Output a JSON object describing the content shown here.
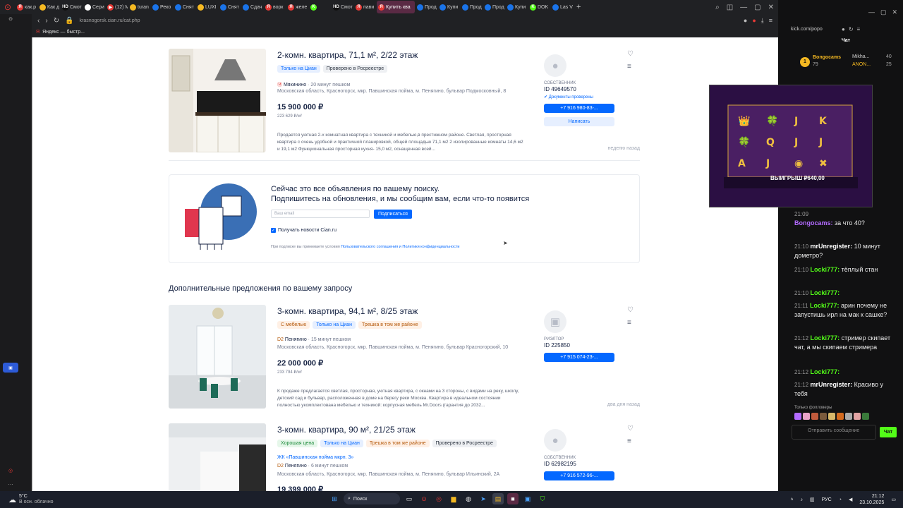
{
  "browser": {
    "tabs": [
      {
        "label": "как.р",
        "color": "#e53935",
        "glyph": "Я"
      },
      {
        "label": "Как д",
        "color": "#f5b922",
        "glyph": ""
      },
      {
        "label": "Смот",
        "color": "#111111",
        "glyph": "HD"
      },
      {
        "label": "Сери",
        "color": "#ffffff",
        "glyph": "▶"
      },
      {
        "label": "(12) М",
        "color": "#e53935",
        "glyph": "▶"
      },
      {
        "label": "turan",
        "color": "#f5b922",
        "glyph": ""
      },
      {
        "label": "Реко",
        "color": "#1a73e8",
        "glyph": ""
      },
      {
        "label": "Снят",
        "color": "#1a73e8",
        "glyph": ""
      },
      {
        "label": "LUXI",
        "color": "#f5b922",
        "glyph": ""
      },
      {
        "label": "Снят",
        "color": "#1a73e8",
        "glyph": ""
      },
      {
        "label": "Сдач",
        "color": "#1a73e8",
        "glyph": ""
      },
      {
        "label": "ворк",
        "color": "#e53935",
        "glyph": "Я"
      },
      {
        "label": "желе",
        "color": "#e53935",
        "glyph": "Я"
      },
      {
        "label": "",
        "color": "#53fc18",
        "glyph": "K"
      },
      {
        "label": "Смот",
        "color": "#111111",
        "glyph": "HD"
      },
      {
        "label": "пави",
        "color": "#e53935",
        "glyph": "Я"
      },
      {
        "label": "Купить ква",
        "color": "#e53935",
        "glyph": "Я",
        "active": true
      },
      {
        "label": "Прод",
        "color": "#1a73e8",
        "glyph": ""
      },
      {
        "label": "Купи",
        "color": "#1a73e8",
        "glyph": ""
      },
      {
        "label": "Прод",
        "color": "#1a73e8",
        "glyph": ""
      },
      {
        "label": "Прод",
        "color": "#1a73e8",
        "glyph": ""
      },
      {
        "label": "Купи",
        "color": "#1a73e8",
        "glyph": ""
      },
      {
        "label": "DOK",
        "color": "#53fc18",
        "glyph": "K"
      },
      {
        "label": "Las V",
        "color": "#1a73e8",
        "glyph": ""
      }
    ],
    "url": "krasnogorsk.cian.ru/cat.php",
    "bookmark": "Яндекс — быстр..."
  },
  "listings": [
    {
      "title": "2-комн. квартира, 71,1 м², 2/22 этаж",
      "chips": [
        {
          "text": "Только на Циан",
          "kind": "blue"
        },
        {
          "text": "Проверено в Росреестре",
          "kind": "grey"
        }
      ],
      "metro": "Мякинино",
      "walk": "· 20 минут пешком",
      "address": "Московская область, Красногорск, мкр. Павшинская пойма, м. Пенягино, бульвар Подмосковный, 8",
      "price": "15 900 000 ₽",
      "price_per_m": "223 629 ₽/м²",
      "description": "Продается уютная 2-х комнатная квартира с техникой и мебелью,в престижном районе. Светлая, просторная квартира с очень удобной и практичной планировкой, общей площадью 71,1 м2 2 изолированные комнаты 14,6 м2 и 19,1 м2 Функциональная просторная кухня- 15,0 м2, оснащенная всей...",
      "agent_role": "собственник",
      "agent_id": "ID 49649570",
      "verified": "Документы проверены",
      "phone": "+7 916 980-83-...",
      "write": "Написать",
      "ago": "неделю назад"
    },
    {
      "title": "3-комн. квартира, 94,1 м², 8/25 этаж",
      "chips": [
        {
          "text": "С мебелью",
          "kind": "orange"
        },
        {
          "text": "Только на Циан",
          "kind": "blue"
        },
        {
          "text": "Трешка в том же районе",
          "kind": "orange"
        }
      ],
      "metro": "Пенягино",
      "walk": "· 15 минут пешком",
      "address": "Московская область, Красногорск, мкр. Павшинская пойма, м. Пенягино, бульвар Красногорский, 10",
      "price": "22 000 000 ₽",
      "price_per_m": "233 794 ₽/м²",
      "description": "К продаже предлагается светлая, просторная, уютная квартира, с окнами на 3 стороны, с видами на реку, школу, детский сад и бульвар, расположенная в доме на берегу реки Москва. Квартира в идеальном состоянии полностью укомплектована мебелью и техникой: корпусная мебель Mr.Doors (гарантия до 2032...",
      "agent_role": "риэлтор",
      "agent_id": "ID 225850",
      "phone": "+7 915 074-23-...",
      "ago": "два дня назад"
    },
    {
      "title": "3-комн. квартира, 90 м², 21/25 этаж",
      "chips": [
        {
          "text": "Хорошая цена",
          "kind": "green"
        },
        {
          "text": "Только на Циан",
          "kind": "blue"
        },
        {
          "text": "Трешка в том же районе",
          "kind": "orange"
        },
        {
          "text": "Проверено в Росреестре",
          "kind": "grey"
        }
      ],
      "complex": "ЖК «Павшинская пойма мкрн. 3»",
      "metro": "Пенягино",
      "walk": "· 6 минут пешком",
      "address": "Московская область, Красногорск, мкр. Павшинская пойма, м. Пенягино, бульвар Ильинский, 2А",
      "price": "19 399 000 ₽",
      "agent_role": "собственник",
      "agent_id": "ID 62982195",
      "phone": "+7 916 572-96-..."
    }
  ],
  "subscribe": {
    "heading_line1": "Сейчас это все объявления по вашему поиску.",
    "heading_line2": "Подпишитесь на обновления, и мы сообщим вам, если что-то появится",
    "email_placeholder": "Ваш email",
    "button": "Подписаться",
    "checkbox": "Получать новости Cian.ru",
    "terms_prefix": "При подписке вы принимаете условия ",
    "terms_link": "Пользовательского соглашения и Политики конфиденциальности"
  },
  "more_title": "Дополнительные предложения по вашему запросу",
  "kick": {
    "address": "kick.com/popo",
    "chat_title": "Чат",
    "top_donor": "Bongocams",
    "top_donor_amount": "79",
    "donors": [
      {
        "name": "Mikha...",
        "value": "40"
      },
      {
        "name": "ANON...",
        "value": "25"
      }
    ],
    "messages": [
      {
        "time": "21:09",
        "user": "",
        "text": "",
        "color": "#ffffff"
      },
      {
        "time": "",
        "user": "Bongocams:",
        "text": "за что 40?",
        "color": "#b36bff"
      },
      {
        "time": "21:10",
        "user": "mrUnregister:",
        "text": "10 минут дометро?",
        "color": "#ffffff"
      },
      {
        "time": "21:10",
        "user": "Locki777:",
        "text": "тёплый стан",
        "color": "#53fc18"
      },
      {
        "time": "21:10",
        "user": "Locki777:",
        "text": "",
        "color": "#53fc18"
      },
      {
        "time": "21:11",
        "user": "Locki777:",
        "text": "арин почему не запустишь ирл на мак к сашке?",
        "color": "#53fc18"
      },
      {
        "time": "21:12",
        "user": "Locki777:",
        "text": "стример скипает чат, а мы скипаем стримера",
        "color": "#53fc18"
      },
      {
        "time": "21:12",
        "user": "Locki777:",
        "text": "",
        "color": "#53fc18"
      },
      {
        "time": "21:12",
        "user": "mrUnregister:",
        "text": "Красиво у тебя",
        "color": "#ffffff"
      }
    ],
    "followers_only": "Только фолловеры",
    "input_placeholder": "Отправить сообщение",
    "send": "Чат",
    "stream_win": "ВЫИГРЫШ ₽640,00"
  },
  "taskbar": {
    "temp": "5°C",
    "weather": "В осн. облачно",
    "search": "Поиск",
    "lang": "РУС",
    "time": "21:12",
    "date": "23.10.2025"
  }
}
